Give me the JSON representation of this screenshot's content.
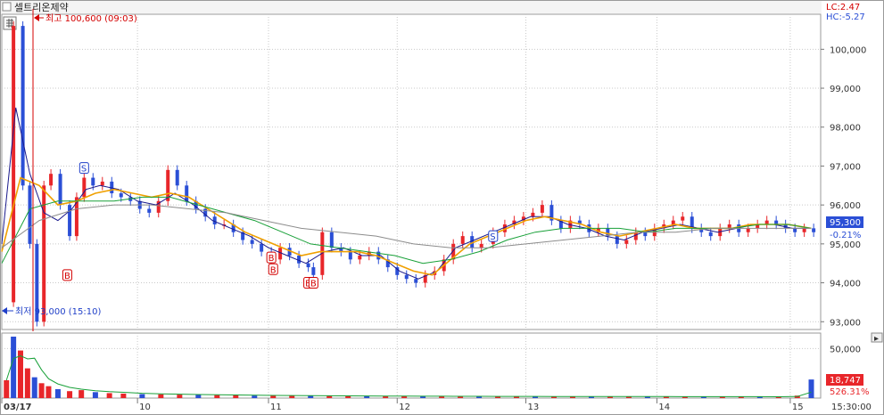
{
  "window": {
    "title": "셀트리온제약",
    "lc_label": "LC:2.47",
    "hc_label": "HC:-5.27"
  },
  "colors": {
    "up": "#e8262a",
    "down": "#2b4fd6",
    "ma_short": "#1a1a8c",
    "ma_mid": "#f0a000",
    "ma_long": "#18a038",
    "ma_xlong": "#8c8c8c",
    "max_marker": "#d40000",
    "min_marker": "#1f3fc8",
    "grid": "#c9c9c9"
  },
  "annotations": {
    "max_label": "최고 100,600 (09:03)",
    "min_label": "최저 93,000 (15:10)"
  },
  "signals": [
    {
      "type": "S",
      "time": 1.76,
      "price": 96.95
    },
    {
      "type": "B",
      "time": 1.4,
      "price": 94.2
    },
    {
      "type": "B",
      "time": 5.76,
      "price": 94.65
    },
    {
      "type": "B",
      "time": 5.8,
      "price": 94.35
    },
    {
      "type": "B",
      "time": 6.55,
      "price": 94.0
    },
    {
      "type": "B",
      "time": 6.66,
      "price": 94.0
    },
    {
      "type": "S",
      "time": 10.5,
      "price": 95.2
    }
  ],
  "chart_data": {
    "type": "line",
    "title": "셀트리온제약",
    "price_axis": {
      "ticks": [
        "100,000",
        "99,000",
        "98,000",
        "97,000",
        "96,000",
        "95,000",
        "94,000",
        "93,000"
      ],
      "ylim": [
        92.8,
        100.9
      ],
      "unit": "thousand KRW"
    },
    "volume_axis": {
      "ticks": [
        "50,000"
      ]
    },
    "x_axis": {
      "date_labels": [
        "03/17",
        "10",
        "11",
        "12",
        "13",
        "14",
        "15",
        "15:30:00"
      ]
    },
    "current_price": {
      "label": "95,300",
      "change": "-0.21%"
    },
    "current_volume": {
      "label": "18,747",
      "ratio": "526.31%"
    },
    "high": {
      "value": 100.6,
      "time": "09:03"
    },
    "low": {
      "value": 93.0,
      "time": "15:10"
    },
    "series": [
      {
        "name": "price",
        "color_key": "down",
        "x": [
          0.0,
          0.25,
          0.45,
          0.6,
          0.75,
          0.9,
          1.05,
          1.25,
          1.45,
          1.6,
          1.76,
          1.95,
          2.15,
          2.35,
          2.55,
          2.75,
          2.95,
          3.15,
          3.35,
          3.55,
          3.75,
          3.95,
          4.15,
          4.35,
          4.55,
          4.75,
          4.95,
          5.15,
          5.35,
          5.55,
          5.76,
          5.95,
          6.15,
          6.35,
          6.55,
          6.66,
          6.85,
          7.05,
          7.25,
          7.45,
          7.65,
          7.85,
          8.05,
          8.25,
          8.45,
          8.65,
          8.85,
          9.05,
          9.25,
          9.45,
          9.65,
          9.85,
          10.05,
          10.25,
          10.5,
          10.75,
          10.95,
          11.15,
          11.35,
          11.55,
          11.75,
          11.95,
          12.15,
          12.35,
          12.55,
          12.75,
          12.95,
          13.15,
          13.35,
          13.55,
          13.75,
          13.95,
          14.15,
          14.35,
          14.55,
          14.75,
          14.95,
          15.15,
          15.35,
          15.55,
          15.75,
          15.95,
          16.15,
          16.35,
          16.55,
          16.75,
          16.95,
          17.15,
          17.35
        ],
        "values": [
          93.5,
          100.6,
          96.5,
          95.0,
          93.0,
          96.5,
          96.8,
          96.0,
          95.2,
          96.2,
          96.7,
          96.5,
          96.6,
          96.3,
          96.2,
          96.1,
          95.9,
          95.8,
          96.1,
          96.9,
          96.5,
          96.1,
          95.9,
          95.7,
          95.5,
          95.5,
          95.3,
          95.1,
          95.0,
          94.8,
          94.6,
          94.9,
          94.7,
          94.5,
          94.4,
          94.2,
          95.3,
          94.9,
          94.8,
          94.6,
          94.7,
          94.8,
          94.6,
          94.4,
          94.2,
          94.1,
          94.0,
          94.2,
          94.3,
          94.6,
          95.0,
          95.2,
          94.9,
          95.0,
          95.3,
          95.5,
          95.6,
          95.7,
          95.8,
          96.0,
          95.6,
          95.4,
          95.6,
          95.5,
          95.3,
          95.4,
          95.2,
          95.0,
          95.1,
          95.3,
          95.2,
          95.4,
          95.5,
          95.6,
          95.7,
          95.4,
          95.3,
          95.2,
          95.4,
          95.5,
          95.3,
          95.4,
          95.5,
          95.6,
          95.5,
          95.4,
          95.3,
          95.4,
          95.3
        ]
      },
      {
        "name": "ma_short",
        "color_key": "ma_short",
        "x": [
          0.0,
          0.3,
          0.6,
          0.9,
          1.2,
          1.5,
          1.8,
          2.1,
          2.5,
          2.9,
          3.3,
          3.7,
          4.1,
          4.5,
          4.9,
          5.3,
          5.7,
          6.1,
          6.5,
          6.9,
          7.3,
          7.7,
          8.1,
          8.5,
          8.9,
          9.3,
          9.7,
          10.1,
          10.5,
          10.9,
          11.3,
          11.7,
          12.1,
          12.5,
          12.9,
          13.3,
          13.7,
          14.1,
          14.5,
          14.9,
          15.3,
          15.7,
          16.1,
          16.5,
          16.9,
          17.3
        ],
        "values": [
          95.0,
          98.5,
          96.8,
          95.8,
          95.6,
          95.9,
          96.4,
          96.5,
          96.4,
          96.1,
          96.0,
          96.3,
          96.0,
          95.6,
          95.4,
          95.2,
          94.9,
          94.7,
          94.5,
          94.8,
          94.9,
          94.7,
          94.7,
          94.3,
          94.1,
          94.3,
          94.9,
          95.1,
          95.3,
          95.5,
          95.7,
          95.7,
          95.5,
          95.4,
          95.2,
          95.1,
          95.3,
          95.4,
          95.5,
          95.4,
          95.3,
          95.4,
          95.5,
          95.5,
          95.4,
          95.4
        ]
      },
      {
        "name": "ma_mid",
        "color_key": "ma_mid",
        "x": [
          0.0,
          0.4,
          0.8,
          1.2,
          1.6,
          2.0,
          2.4,
          2.8,
          3.2,
          3.6,
          4.0,
          4.4,
          4.8,
          5.2,
          5.6,
          6.0,
          6.4,
          6.8,
          7.2,
          7.6,
          8.0,
          8.4,
          8.8,
          9.2,
          9.6,
          10.0,
          10.4,
          10.8,
          11.2,
          11.6,
          12.0,
          12.4,
          12.8,
          13.2,
          13.6,
          14.0,
          14.4,
          14.8,
          15.2,
          15.6,
          16.0,
          16.4,
          16.8,
          17.3
        ],
        "values": [
          94.8,
          96.7,
          96.5,
          96.0,
          96.1,
          96.3,
          96.4,
          96.3,
          96.2,
          96.3,
          96.2,
          95.9,
          95.6,
          95.3,
          95.1,
          94.9,
          94.7,
          94.8,
          94.8,
          94.8,
          94.7,
          94.5,
          94.3,
          94.2,
          94.6,
          95.0,
          95.2,
          95.4,
          95.6,
          95.7,
          95.6,
          95.5,
          95.3,
          95.2,
          95.3,
          95.4,
          95.5,
          95.4,
          95.4,
          95.4,
          95.5,
          95.5,
          95.5,
          95.4
        ]
      },
      {
        "name": "ma_long",
        "color_key": "ma_long",
        "x": [
          0.0,
          0.6,
          1.2,
          1.8,
          2.4,
          3.0,
          3.6,
          4.2,
          4.8,
          5.4,
          6.0,
          6.6,
          7.2,
          7.8,
          8.4,
          9.0,
          9.6,
          10.2,
          10.8,
          11.4,
          12.0,
          12.6,
          13.2,
          13.8,
          14.4,
          15.0,
          15.6,
          16.2,
          16.8,
          17.3
        ],
        "values": [
          94.5,
          95.9,
          96.1,
          96.1,
          96.1,
          96.2,
          96.2,
          96.0,
          95.8,
          95.6,
          95.3,
          95.0,
          94.9,
          94.8,
          94.7,
          94.5,
          94.6,
          94.8,
          95.1,
          95.3,
          95.4,
          95.4,
          95.4,
          95.3,
          95.4,
          95.4,
          95.4,
          95.5,
          95.5,
          95.4
        ]
      },
      {
        "name": "ma_xlong",
        "color_key": "ma_xlong",
        "x": [
          0.0,
          0.8,
          1.6,
          2.4,
          3.2,
          4.0,
          4.8,
          5.6,
          6.4,
          7.2,
          8.0,
          8.8,
          9.6,
          10.4,
          11.2,
          12.0,
          12.8,
          13.6,
          14.4,
          15.2,
          16.0,
          16.8,
          17.3
        ],
        "values": [
          94.9,
          95.6,
          95.9,
          96.0,
          96.0,
          95.9,
          95.8,
          95.6,
          95.4,
          95.3,
          95.2,
          95.0,
          94.9,
          94.9,
          95.0,
          95.1,
          95.2,
          95.3,
          95.3,
          95.4,
          95.4,
          95.4,
          95.4
        ]
      }
    ],
    "volume_series": {
      "x": [
        0.1,
        0.25,
        0.4,
        0.55,
        0.7,
        0.85,
        1.0,
        1.2,
        1.45,
        1.7,
        2.0,
        2.3,
        2.6,
        3.0,
        3.4,
        3.8,
        4.2,
        4.6,
        5.0,
        5.4,
        5.8,
        6.2,
        6.6,
        7.0,
        7.4,
        7.8,
        8.2,
        8.6,
        9.0,
        9.4,
        9.8,
        10.2,
        10.6,
        11.0,
        11.4,
        11.8,
        12.2,
        12.6,
        13.0,
        13.4,
        13.8,
        14.2,
        14.6,
        15.0,
        15.4,
        15.8,
        16.2,
        16.6,
        17.0,
        17.3
      ],
      "values": [
        18000,
        62000,
        48000,
        30000,
        21000,
        15000,
        12000,
        9000,
        7000,
        8000,
        6000,
        5000,
        4500,
        4000,
        3800,
        3500,
        3200,
        3000,
        2800,
        2600,
        2500,
        2400,
        2300,
        2200,
        2100,
        2000,
        1900,
        1900,
        1800,
        1800,
        1800,
        1700,
        1700,
        1700,
        1600,
        1600,
        1600,
        1500,
        1500,
        1500,
        1500,
        1500,
        1400,
        1400,
        1400,
        1400,
        1400,
        1300,
        2500,
        18747
      ]
    }
  }
}
